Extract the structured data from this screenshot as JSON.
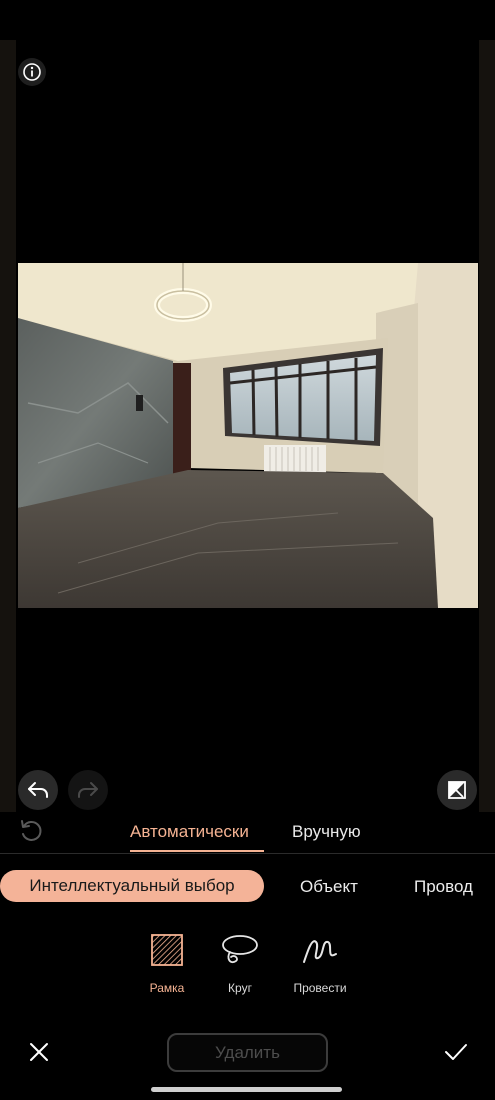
{
  "editor": {
    "mode_tabs": [
      {
        "label": "Автоматически",
        "active": true
      },
      {
        "label": "Вручную",
        "active": false
      }
    ],
    "selection_types": [
      {
        "label": "Интеллектуальный выбор",
        "active": true
      },
      {
        "label": "Объект",
        "active": false
      },
      {
        "label": "Провод",
        "active": false
      }
    ],
    "tools": [
      {
        "label": "Рамка",
        "icon": "frame-icon",
        "active": true
      },
      {
        "label": "Круг",
        "icon": "lasso-icon",
        "active": false
      },
      {
        "label": "Провести",
        "icon": "brush-stroke-icon",
        "active": false
      }
    ],
    "delete_label": "Удалить",
    "accent_color": "#f5b393"
  },
  "photo": {
    "subject": "empty room interior"
  }
}
